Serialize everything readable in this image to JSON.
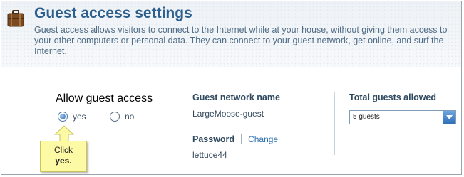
{
  "header": {
    "title": "Guest access settings",
    "description": "Guest access allows visitors to connect to the Internet while at your house, without giving them access to your other computers or personal data. They can connect to your guest network, get online, and surf the Internet."
  },
  "guest_access": {
    "label": "Allow guest access",
    "options": [
      {
        "label": "yes",
        "selected": true
      },
      {
        "label": "no",
        "selected": false
      }
    ]
  },
  "network": {
    "name_label": "Guest network name",
    "name_value": "LargeMoose-guest",
    "password_label": "Password",
    "change_link": "Change",
    "password_value": "lettuce44"
  },
  "guests": {
    "label": "Total guests allowed",
    "selected": "5 guests"
  },
  "callout": {
    "line1": "Click",
    "line2": "yes."
  },
  "colors": {
    "title": "#2c5f8d",
    "link": "#2e72b3",
    "callout_bg": "#fdfaa6",
    "radio_selected": "#2d6db4"
  },
  "icons": {
    "header": "suitcase-icon",
    "dropdown": "chevron-down-icon"
  }
}
